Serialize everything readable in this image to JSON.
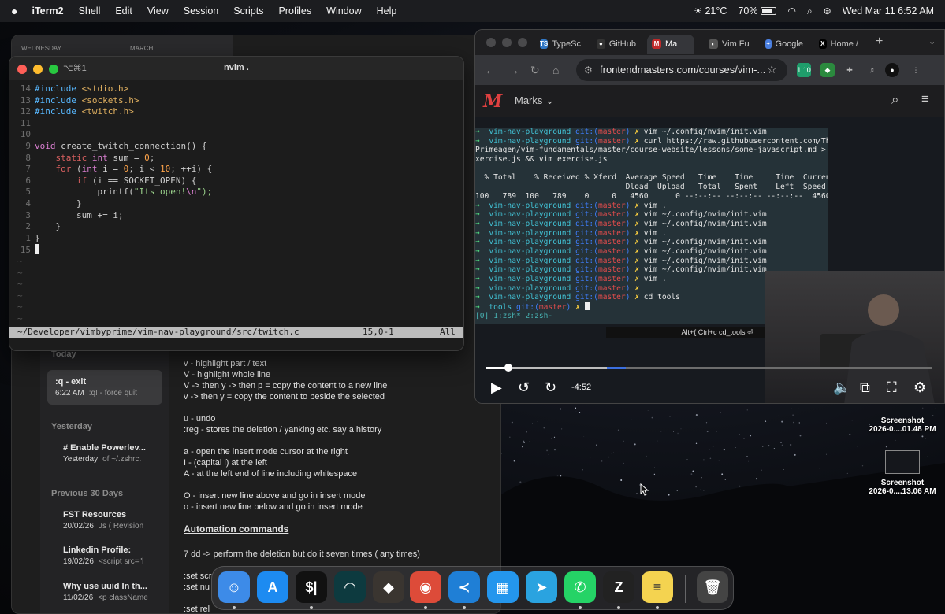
{
  "menubar": {
    "apple": "",
    "app_name": "iTerm2",
    "items": [
      "Shell",
      "Edit",
      "View",
      "Session",
      "Scripts",
      "Profiles",
      "Window",
      "Help"
    ],
    "weather": "21°C",
    "battery": "70%",
    "battery_level": 0.7,
    "datetime": "Wed Mar 11  6:52 AM"
  },
  "notes": {
    "calendar": {
      "day": "WEDNESDAY",
      "month": "MARCH"
    },
    "sections": {
      "today": "Today",
      "yesterday": "Yesterday",
      "previous": "Previous 30 Days"
    },
    "list": [
      {
        "title": ":q - exit",
        "time": "6:22 AM",
        "snippet": ":q! - force quit"
      },
      {
        "title": "# Enable Powerlev...",
        "time": "Yesterday",
        "snippet": "of ~/.zshrc."
      },
      {
        "title": "FST Resources",
        "time": "20/02/26",
        "snippet": "Js ( Revision"
      },
      {
        "title": "Linkedin Profile:",
        "time": "19/02/26",
        "snippet": "<script src=\"l"
      },
      {
        "title": "Why use uuid In th...",
        "time": "11/02/26",
        "snippet": "<p className"
      }
    ],
    "body": [
      "v - highlight part / text",
      "V - highlight whole line",
      "V -> then y -> then p = copy the content to a new line",
      "v -> then y  = copy the content to beside the selected",
      "",
      " u - undo",
      ":reg - stores the deletion / yanking etc. say a history",
      "",
      "a - open the insert mode cursor at the right",
      "I - (capital i) at the left",
      "A - at the left end of line including whitespace",
      "",
      "O - insert new line above and go in insert mode",
      "o -  insert new line below and go in insert mode"
    ],
    "heading": "Automation commands",
    "body2": [
      "7 dd -> perform  the deletion but do it seven times ( any times)",
      "",
      ":set scr",
      ":set nu",
      "",
      ":set rel"
    ]
  },
  "terminal": {
    "shortcut": "⌥⌘1",
    "title": "nvim .",
    "code": [
      {
        "ln": "14",
        "kind": "inc",
        "text": "<stdio.h>"
      },
      {
        "ln": "13",
        "kind": "inc",
        "text": "<sockets.h>"
      },
      {
        "ln": "12",
        "kind": "inc",
        "text": "<twitch.h>"
      },
      {
        "ln": "11",
        "kind": "blank"
      },
      {
        "ln": "10",
        "kind": "blank"
      },
      {
        "ln": "9",
        "kind": "fn"
      },
      {
        "ln": "8",
        "kind": "static"
      },
      {
        "ln": "7",
        "kind": "for"
      },
      {
        "ln": "6",
        "kind": "if"
      },
      {
        "ln": "5",
        "kind": "printf"
      },
      {
        "ln": "4",
        "kind": "close2"
      },
      {
        "ln": "3",
        "kind": "sum"
      },
      {
        "ln": "2",
        "kind": "close1"
      },
      {
        "ln": "1",
        "kind": "close0"
      },
      {
        "ln": "15",
        "kind": "cursor"
      }
    ],
    "tokens": {
      "include": "#include",
      "void": "void",
      "fn_name": "create_twitch_connection() {",
      "static": "static",
      "int": "int",
      "sum_decl": "sum = ",
      "zero": "0",
      "for": "for",
      "for_i": "i = ",
      "for_cond": "; i < ",
      "ten": "10",
      "for_end": "; ++i) {",
      "if": "if",
      "if_cond": "(i == SOCKET_OPEN) {",
      "printf": "printf(",
      "str": "\"Its open!",
      "esc": "\\n",
      "str_end": "\");",
      "sum_line": "sum += i;"
    },
    "tildes": 6,
    "status": {
      "path": "~/Developer/vimbyprime/vim-nav-playground/src/twitch.c",
      "pos": "15,0-1",
      "scroll": "All"
    }
  },
  "browser": {
    "tabs": [
      {
        "label": "TypeSc",
        "fav": "TS",
        "color": "#3178c6"
      },
      {
        "label": "GitHub",
        "fav": "●",
        "color": "#333"
      },
      {
        "label": "Ma",
        "fav": "M",
        "color": "#c02a2a",
        "active": true
      },
      {
        "label": "Vim Fu",
        "fav": "◐",
        "color": "#555"
      },
      {
        "label": "Google",
        "fav": "✦",
        "color": "#4a7fe0"
      },
      {
        "label": "Home /",
        "fav": "X",
        "color": "#000"
      }
    ],
    "url": "frontendmasters.com/courses/vim-...",
    "ext_badge": "1.10",
    "site_logo": "M",
    "marks_label": "Marks",
    "time_remaining": "-4:52",
    "progress": {
      "played": 0.05,
      "buffered": 0.27
    },
    "shell": {
      "prompt_dir": "vim-nav-playground",
      "git": "git:(",
      "branch": "master",
      "git_end": ")",
      "tools_dir": "tools",
      "lines": [
        {
          "type": "prompt",
          "cmd": "vim ~/.config/nvim/init.vim"
        },
        {
          "type": "prompt",
          "cmd": "curl https://raw.githubusercontent.com/The"
        },
        {
          "type": "plain",
          "text": "Primeagen/vim-fundamentals/master/course-website/lessons/some-javascript.md > e"
        },
        {
          "type": "plain",
          "text": "xercise.js && vim exercise.js"
        },
        {
          "type": "plain",
          "text": ""
        },
        {
          "type": "plain",
          "text": "  % Total    % Received % Xferd  Average Speed   Time    Time     Time  Current"
        },
        {
          "type": "plain",
          "text": "                                 Dload  Upload   Total   Spent    Left  Speed"
        },
        {
          "type": "plain",
          "text": "100   789  100   789    0     0   4560      0 --:--:-- --:--:-- --:--:--  4560"
        },
        {
          "type": "prompt",
          "cmd": "vim ."
        },
        {
          "type": "prompt",
          "cmd": "vim ~/.config/nvim/init.vim"
        },
        {
          "type": "prompt",
          "cmd": "vim ~/.config/nvim/init.vim"
        },
        {
          "type": "prompt",
          "cmd": "vim ."
        },
        {
          "type": "prompt",
          "cmd": "vim ~/.config/nvim/init.vim"
        },
        {
          "type": "prompt",
          "cmd": "vim ~/.config/nvim/init.vim"
        },
        {
          "type": "prompt",
          "cmd": "vim ~/.config/nvim/init.vim"
        },
        {
          "type": "prompt",
          "cmd": "vim ~/.config/nvim/init.vim"
        },
        {
          "type": "prompt",
          "cmd": "vim ."
        },
        {
          "type": "prompt",
          "cmd": ""
        },
        {
          "type": "prompt",
          "cmd": "cd tools"
        },
        {
          "type": "tools",
          "cmd": ""
        }
      ],
      "tmux_bar": "[0] 1:zsh* 2:zsh-",
      "hint": "Alt+{ Ctrl+c cd_tools ⏎"
    }
  },
  "desktop": {
    "files": [
      {
        "name": "Screenshot",
        "date": "2026-0....01.48 PM"
      },
      {
        "name": "Screenshot",
        "date": "2026-0....13.06 AM"
      }
    ]
  },
  "dock": {
    "apps": [
      {
        "name": "finder",
        "glyph": "☺",
        "color": "#3d8be8",
        "running": true
      },
      {
        "name": "app-store",
        "glyph": "A",
        "color": "#1d8bf1",
        "running": false
      },
      {
        "name": "iterm",
        "glyph": "$|",
        "color": "#111",
        "running": true
      },
      {
        "name": "warp",
        "glyph": "◠",
        "color": "#0d3a3f",
        "running": false
      },
      {
        "name": "box",
        "glyph": "◆",
        "color": "#3a3530",
        "running": false
      },
      {
        "name": "chrome",
        "glyph": "◉",
        "color": "#dd4b39",
        "running": true
      },
      {
        "name": "vscode",
        "glyph": "≺",
        "color": "#1f7fd6",
        "running": true
      },
      {
        "name": "docker",
        "glyph": "▦",
        "color": "#2496ed",
        "running": false
      },
      {
        "name": "telegram",
        "glyph": "➤",
        "color": "#2aa3e0",
        "running": false
      },
      {
        "name": "whatsapp",
        "glyph": "✆",
        "color": "#25d366",
        "running": true
      },
      {
        "name": "zed",
        "glyph": "Z",
        "color": "#222",
        "running": true
      },
      {
        "name": "notes",
        "glyph": "≡",
        "color": "#f4d350",
        "running": true
      },
      {
        "name": "trash",
        "glyph": "🗑",
        "color": "#444",
        "running": false
      }
    ]
  }
}
